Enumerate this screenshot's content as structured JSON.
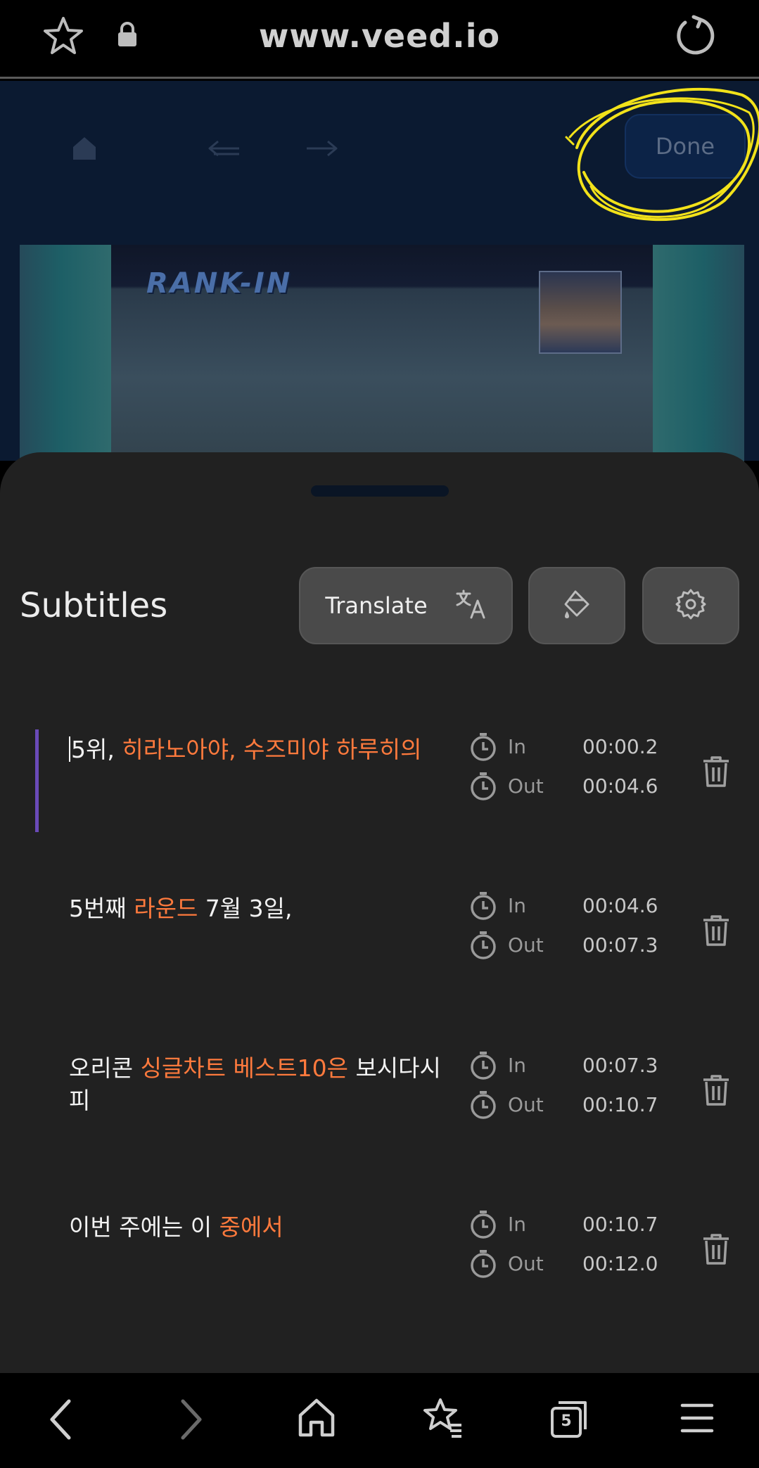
{
  "browser": {
    "url": "www.veed.io"
  },
  "editor": {
    "done_label": "Done",
    "preview_overlay_text": "RANK-IN"
  },
  "subtitles_panel": {
    "title": "Subtitles",
    "translate_label": "Translate",
    "time_in_label": "In",
    "time_out_label": "Out",
    "items": [
      {
        "parts": [
          {
            "text": "5위, ",
            "highlight": false
          },
          {
            "text": "히라노아야, 수즈미야 하루히의",
            "highlight": true
          }
        ],
        "in": "00:00.2",
        "out": "00:04.6"
      },
      {
        "parts": [
          {
            "text": "5번째 ",
            "highlight": false
          },
          {
            "text": "라운드",
            "highlight": true
          },
          {
            "text": " 7월 3일,",
            "highlight": false
          }
        ],
        "in": "00:04.6",
        "out": "00:07.3"
      },
      {
        "parts": [
          {
            "text": "오리콘 ",
            "highlight": false
          },
          {
            "text": "싱글차트 베스트10은",
            "highlight": true
          },
          {
            "text": " 보시다시피",
            "highlight": false
          }
        ],
        "in": "00:07.3",
        "out": "00:10.7"
      },
      {
        "parts": [
          {
            "text": "이번 주에는 이 ",
            "highlight": false
          },
          {
            "text": "중에서",
            "highlight": true
          }
        ],
        "in": "00:10.7",
        "out": "00:12.0"
      }
    ]
  },
  "navbar": {
    "tabs_count": "5"
  },
  "colors": {
    "highlight": "#ff7a3d",
    "active_accent": "#6a4ab8",
    "annotation": "#f2e21a"
  },
  "icons": [
    "star-icon",
    "lock-icon",
    "reload-icon",
    "home-icon",
    "undo-icon",
    "redo-icon",
    "translate-icon",
    "paint-bucket-icon",
    "gear-icon",
    "clock-icon",
    "trash-icon",
    "back-icon",
    "forward-icon",
    "bookmarks-icon",
    "tabs-icon",
    "menu-icon"
  ]
}
